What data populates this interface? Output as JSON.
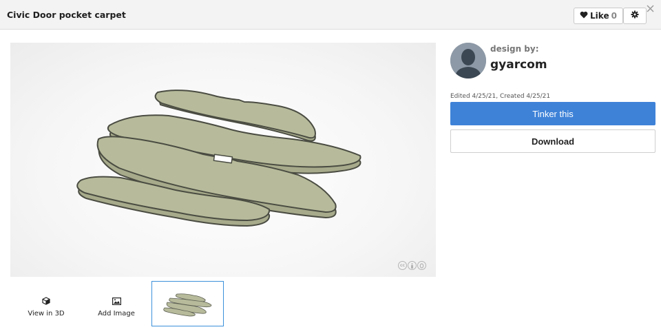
{
  "header": {
    "title": "Civic Door pocket carpet",
    "like_label": "Like",
    "like_count": "0"
  },
  "viewer": {
    "license_icons": [
      "cc-icon",
      "attribution-icon",
      "zero-icon"
    ],
    "license_cc": "cc"
  },
  "thumbnails": {
    "view_3d_label": "View in 3D",
    "add_image_label": "Add Image"
  },
  "designer": {
    "design_by_label": "design by:",
    "name": "gyarcom",
    "edited_text": "Edited 4/25/21, Created 4/25/21"
  },
  "actions": {
    "tinker_label": "Tinker this",
    "download_label": "Download"
  },
  "colors": {
    "accent": "#3e82d8",
    "model_fill": "#b7bb9b",
    "model_edge": "#4a4c42"
  }
}
